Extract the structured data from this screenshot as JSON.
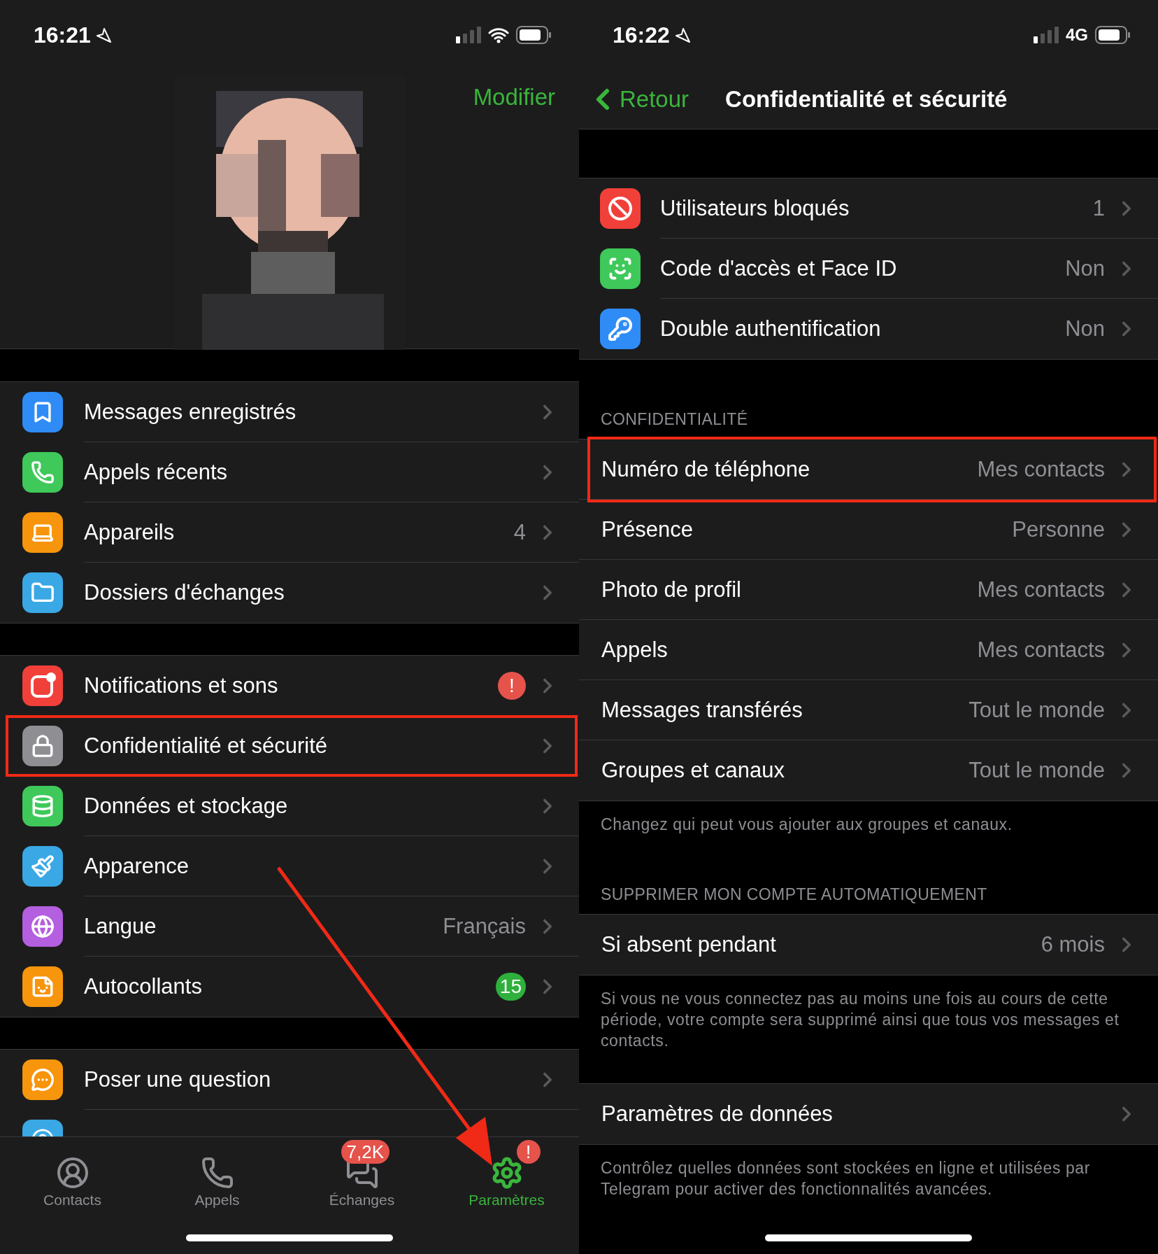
{
  "left_screen": {
    "status_bar": {
      "time": "16:21"
    },
    "profile": {
      "edit_button": "Modifier"
    },
    "groups": [
      {
        "items": [
          {
            "label": "Messages enregistrés",
            "color": "#2f8cf6"
          },
          {
            "label": "Appels récents",
            "color": "#3ec95a"
          },
          {
            "label": "Appareils",
            "value": "4",
            "color": "#f7950c"
          },
          {
            "label": "Dossiers d'échanges",
            "color": "#3aa8e4"
          }
        ]
      },
      {
        "items": [
          {
            "label": "Notifications et sons",
            "badge": {
              "text": "!",
              "color": "#e5534b"
            },
            "color": "#f1403a",
            "highlighted": false
          },
          {
            "label": "Confidentialité et sécurité",
            "color": "#8e8e93",
            "highlighted": true
          },
          {
            "label": "Données et stockage",
            "color": "#3ec95a",
            "highlighted": false
          },
          {
            "label": "Apparence",
            "color": "#3aa8e4",
            "highlighted": false
          },
          {
            "label": "Langue",
            "value": "Français",
            "color": "#b45ee0",
            "highlighted": false
          },
          {
            "label": "Autocollants",
            "badge": {
              "text": "15",
              "color": "#2fb03c"
            },
            "color": "#f7950c",
            "highlighted": false
          }
        ]
      },
      {
        "items": [
          {
            "label": "Poser une question",
            "color": "#f7950c"
          }
        ]
      }
    ],
    "tab_bar": [
      {
        "label": "Contacts",
        "selected": false
      },
      {
        "label": "Appels",
        "selected": false
      },
      {
        "label": "Échanges",
        "selected": false,
        "badge": "7,2K"
      },
      {
        "label": "Paramètres",
        "selected": true,
        "badge": "!"
      }
    ]
  },
  "right_screen": {
    "status_bar": {
      "time": "16:22",
      "network": "4G"
    },
    "nav_bar": {
      "back": "Retour",
      "title": "Confidentialité et sécurité"
    },
    "security": [
      {
        "label": "Utilisateurs bloqués",
        "value": "1",
        "color": "#f1403a"
      },
      {
        "label": "Code d'accès et Face ID",
        "value": "Non",
        "color": "#3ec95a"
      },
      {
        "label": "Double authentification",
        "value": "Non",
        "color": "#2f8cf6"
      }
    ],
    "sections": [
      {
        "header": "CONFIDENTIALITÉ",
        "items": [
          {
            "label": "Numéro de téléphone",
            "value": "Mes contacts",
            "highlighted": true
          },
          {
            "label": "Présence",
            "value": "Personne",
            "highlighted": false
          },
          {
            "label": "Photo de profil",
            "value": "Mes contacts",
            "highlighted": false
          },
          {
            "label": "Appels",
            "value": "Mes contacts",
            "highlighted": false
          },
          {
            "label": "Messages transférés",
            "value": "Tout le monde",
            "highlighted": false
          },
          {
            "label": "Groupes et canaux",
            "value": "Tout le monde",
            "highlighted": false
          }
        ],
        "footer": "Changez qui peut vous ajouter aux groupes et canaux."
      },
      {
        "header": "SUPPRIMER MON COMPTE AUTOMATIQUEMENT",
        "items": [
          {
            "label": "Si absent pendant",
            "value": "6 mois"
          }
        ],
        "footer": "Si vous ne vous connectez pas au moins une fois au cours de cette période, votre compte sera supprimé ainsi que tous vos messages et contacts."
      },
      {
        "items": [
          {
            "label": "Paramètres de données"
          }
        ],
        "footer": "Contrôlez quelles données sont stockées en ligne et utilisées par Telegram pour activer des fonctionnalités avancées."
      }
    ]
  }
}
